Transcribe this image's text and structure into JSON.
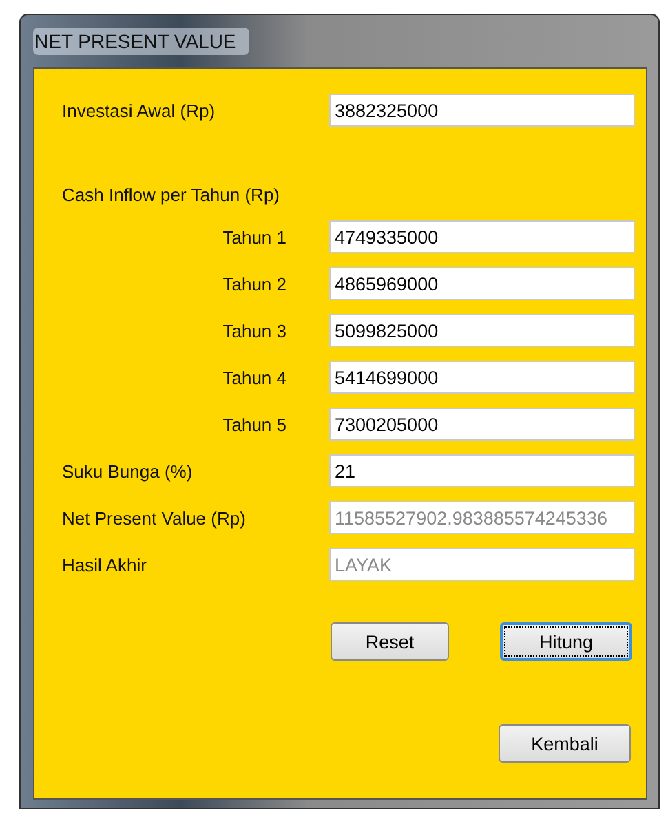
{
  "window": {
    "title": "NET PRESENT VALUE"
  },
  "rows": [
    {
      "kind": "field",
      "label": "Investasi Awal (Rp)",
      "value": "3882325000",
      "disabled": false
    },
    {
      "kind": "heading",
      "label": "Cash Inflow per Tahun (Rp)"
    },
    {
      "kind": "sub",
      "label": "Tahun 1",
      "value": "4749335000",
      "disabled": false
    },
    {
      "kind": "sub",
      "label": "Tahun 2",
      "value": "4865969000",
      "disabled": false
    },
    {
      "kind": "sub",
      "label": "Tahun 3",
      "value": "5099825000",
      "disabled": false
    },
    {
      "kind": "sub",
      "label": "Tahun 4",
      "value": "5414699000",
      "disabled": false
    },
    {
      "kind": "sub",
      "label": "Tahun 5",
      "value": "7300205000",
      "disabled": false
    },
    {
      "kind": "field",
      "label": "Suku Bunga (%)",
      "value": "21",
      "disabled": false
    },
    {
      "kind": "field",
      "label": "Net Present Value (Rp)",
      "value": "11585527902.983885574245336",
      "disabled": true
    },
    {
      "kind": "field",
      "label": "Hasil Akhir",
      "value": "LAYAK",
      "disabled": true
    }
  ],
  "buttons": [
    {
      "label": "Reset",
      "focused": false
    },
    {
      "label": "Hitung",
      "focused": true
    }
  ],
  "back_button": {
    "label": "Kembali",
    "focused": false
  }
}
